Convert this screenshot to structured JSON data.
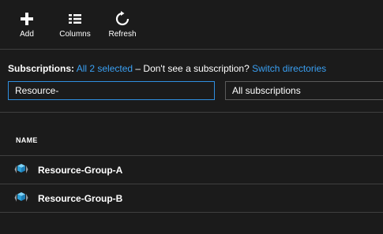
{
  "toolbar": {
    "add_label": "Add",
    "columns_label": "Columns",
    "refresh_label": "Refresh"
  },
  "subscriptions": {
    "label": "Subscriptions:",
    "selected_link": "All 2 selected",
    "dont_see_text": "– Don't see a subscription?",
    "switch_link": "Switch directories"
  },
  "filter": {
    "search_value": "Resource-",
    "subscription_filter": "All subscriptions"
  },
  "table": {
    "name_header": "NAME",
    "rows": [
      {
        "name": "Resource-Group-A",
        "icon": "resource-group-icon"
      },
      {
        "name": "Resource-Group-B",
        "icon": "resource-group-icon"
      }
    ]
  },
  "colors": {
    "background": "#1b1b1b",
    "link": "#3aa0f3",
    "search_border": "#2f8fe0",
    "divider": "#3f3f3f"
  }
}
